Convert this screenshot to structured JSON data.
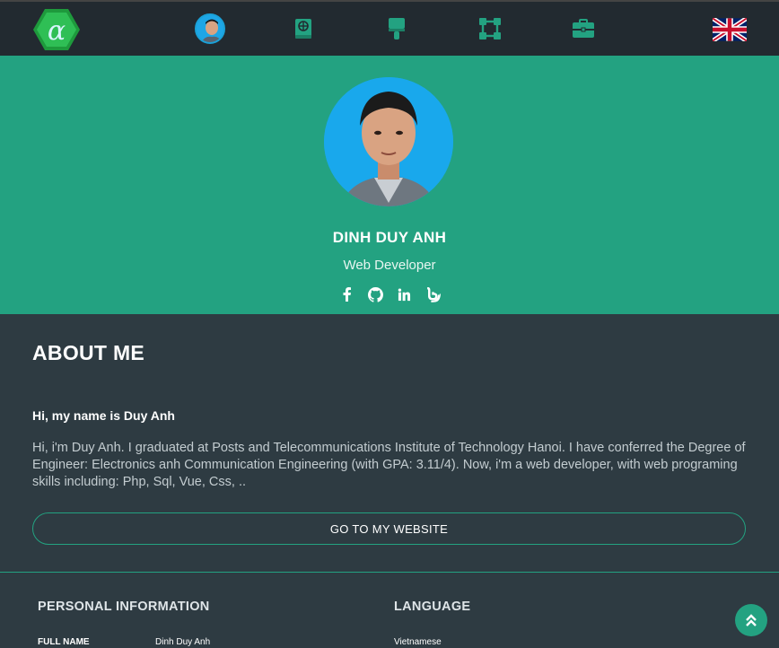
{
  "nav": {
    "logo_icon": "alpha-hexagon-logo",
    "items": [
      {
        "name": "profile",
        "icon": "avatar-icon"
      },
      {
        "name": "resume",
        "icon": "book-icon"
      },
      {
        "name": "design",
        "icon": "paintbrush-icon"
      },
      {
        "name": "skills",
        "icon": "vector-square-icon"
      },
      {
        "name": "portfolio",
        "icon": "briefcase-icon"
      }
    ],
    "language_flag": "uk-flag-icon"
  },
  "hero": {
    "name": "DINH DUY ANH",
    "role": "Web Developer",
    "socials": [
      "facebook-icon",
      "github-icon",
      "linkedin-icon",
      "blogger-icon"
    ]
  },
  "about": {
    "title": "ABOUT ME",
    "greeting": "Hi, my name is Duy Anh",
    "bio": "Hi, i'm Duy Anh. I graduated at Posts and Telecommunications Institute of Technology Hanoi. I have conferred the Degree of Engineer: Electronics anh Communication Engineering (with GPA: 3.11/4). Now, i'm a web developer, with web programing skills including: Php, Sql, Vue, Css, ..",
    "button_label": "GO TO MY WEBSITE"
  },
  "info": {
    "personal_title": "PERSONAL INFORMATION",
    "language_title": "LANGUAGE",
    "full_name_label": "FULL NAME",
    "full_name_value": "Dinh Duy Anh",
    "language_value": "Vietnamese"
  },
  "colors": {
    "accent": "#23a281",
    "topbar": "#222a30",
    "background": "#2e3b42"
  }
}
